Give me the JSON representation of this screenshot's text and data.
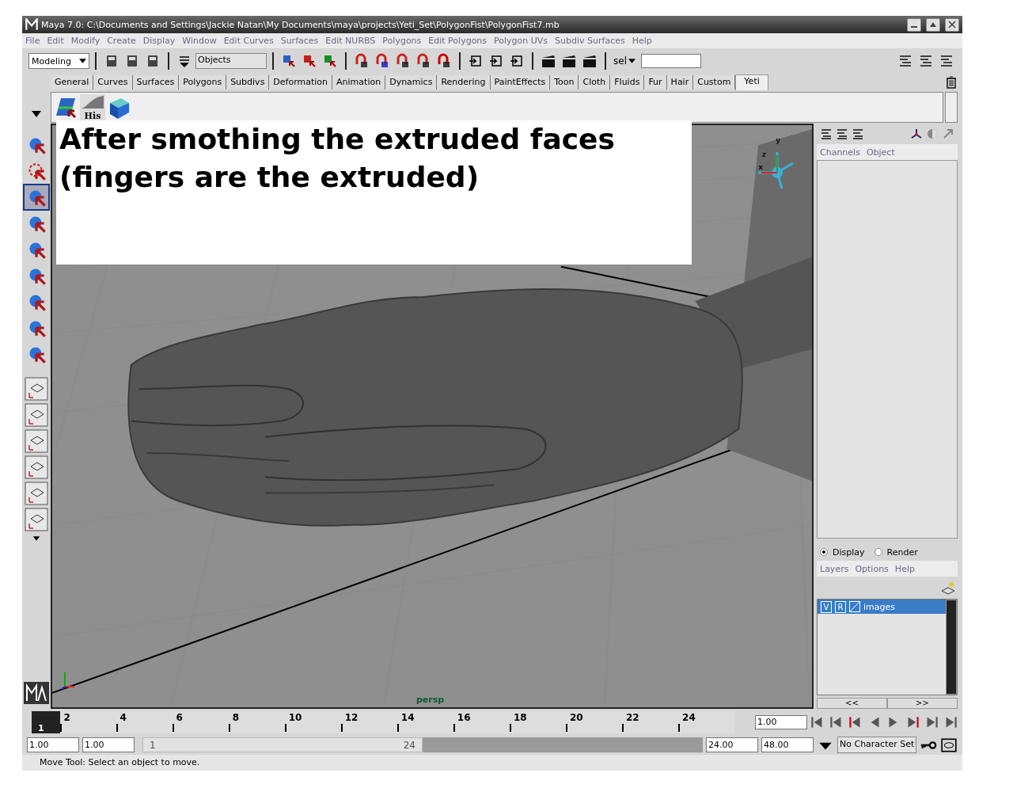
{
  "window": {
    "title": "Maya 7.0: C:\\Documents and Settings\\Jackie Natan\\My Documents\\maya\\projects\\Yeti_Set\\PolygonFist\\PolygonFist7.mb"
  },
  "menu": [
    "File",
    "Edit",
    "Modify",
    "Create",
    "Display",
    "Window",
    "Edit Curves",
    "Surfaces",
    "Edit NURBS",
    "Polygons",
    "Edit Polygons",
    "Polygon UVs",
    "Subdiv Surfaces",
    "Help"
  ],
  "toolbar": {
    "mode": "Modeling",
    "selection_field": "Objects",
    "quick_select_label": "sel"
  },
  "shelf_tabs": [
    {
      "label": "General",
      "selected": false
    },
    {
      "label": "Curves",
      "selected": false
    },
    {
      "label": "Surfaces",
      "selected": false
    },
    {
      "label": "Polygons",
      "selected": false
    },
    {
      "label": "Subdivs",
      "selected": false
    },
    {
      "label": "Deformation",
      "selected": false
    },
    {
      "label": "Animation",
      "selected": false
    },
    {
      "label": "Dynamics",
      "selected": false
    },
    {
      "label": "Rendering",
      "selected": false
    },
    {
      "label": "PaintEffects",
      "selected": false
    },
    {
      "label": "Toon",
      "selected": false
    },
    {
      "label": "Cloth",
      "selected": false
    },
    {
      "label": "Fluids",
      "selected": false
    },
    {
      "label": "Fur",
      "selected": false
    },
    {
      "label": "Hair",
      "selected": false
    },
    {
      "label": "Custom",
      "selected": false
    },
    {
      "label": "Yeti",
      "selected": true
    }
  ],
  "shelf": {
    "button_label": "His"
  },
  "annotation": [
    "After smothing the extruded faces",
    "(fingers are the extruded)"
  ],
  "viewport": {
    "camera_label": "persp",
    "axis_labels": [
      "x",
      "y",
      "z"
    ]
  },
  "channel_box": {
    "menu": [
      "Channels",
      "Object"
    ]
  },
  "layer_editor": {
    "modes": [
      {
        "label": "Display",
        "selected": true
      },
      {
        "label": "Render",
        "selected": false
      }
    ],
    "menu": [
      "Layers",
      "Options",
      "Help"
    ],
    "layers": [
      {
        "visible_label": "V",
        "render_label": "R",
        "name": "images",
        "selected": true
      }
    ],
    "scroll_left": "<<",
    "scroll_right": ">>"
  },
  "timeline": {
    "current_frame": "1",
    "level": 0.04,
    "ticks": [
      "2",
      "4",
      "6",
      "8",
      "10",
      "12",
      "14",
      "16",
      "18",
      "20",
      "22",
      "24"
    ],
    "current_time": "1.00"
  },
  "range": {
    "start": "1.00",
    "playback_start": "1.00",
    "slider_start": "1",
    "slider_end": "24",
    "level": 0.5,
    "playback_end": "24.00",
    "end": "48.00",
    "character_set": "No Character Set"
  },
  "help_line": "Move Tool: Select an object to move."
}
